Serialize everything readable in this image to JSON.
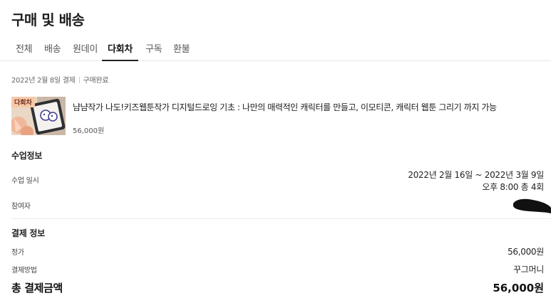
{
  "page_title": "구매 및 배송",
  "tabs": [
    {
      "label": "전체"
    },
    {
      "label": "배송"
    },
    {
      "label": "원데이"
    },
    {
      "label": "다회차"
    },
    {
      "label": "구독"
    },
    {
      "label": "환불"
    }
  ],
  "active_tab": "다회차",
  "order": {
    "date": "2022년 2월 8일 결제",
    "status": "구매완료"
  },
  "product": {
    "thumbnail_badge": "다회차",
    "title": "냠냠작가 나도!키즈웹툰작가 디지털드로잉 기초 : 나만의 매력적인 캐릭터를 만들고, 이모티콘, 캐릭터 웹툰 그리기 까지 가능",
    "price": "56,000원"
  },
  "class_info": {
    "heading": "수업정보",
    "schedule_label": "수업 일시",
    "schedule_dates": "2022년 2월 16일 ~ 2022년 3월 9일",
    "schedule_time": "오후 8:00 총 4회",
    "participant_label": "참여자"
  },
  "payment": {
    "heading": "결제 정보",
    "list_price_label": "정가",
    "list_price": "56,000원",
    "method_label": "결제방법",
    "method": "꾸그머니",
    "total_label": "총 결제금액",
    "total": "56,000원"
  }
}
